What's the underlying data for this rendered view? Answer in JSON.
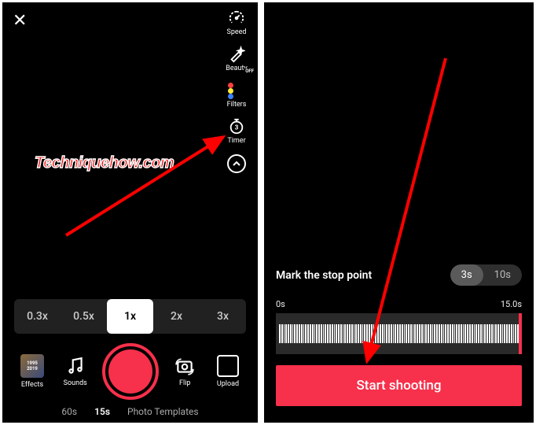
{
  "watermark": "Techniquehow.com",
  "left": {
    "tools": [
      {
        "label": "Speed",
        "name": "speed"
      },
      {
        "label": "Beauty",
        "name": "beauty",
        "off": "OFF"
      },
      {
        "label": "Filters",
        "name": "filters"
      },
      {
        "label": "Timer",
        "name": "timer",
        "badge": "3"
      }
    ],
    "speeds": [
      "0.3x",
      "0.5x",
      "1x",
      "2x",
      "3x"
    ],
    "speed_active": "1x",
    "bottom": {
      "effects": "Effects",
      "sounds": "Sounds",
      "flip": "Flip",
      "upload": "Upload",
      "thumb_top": "1995",
      "thumb_bot": "2019"
    },
    "modes": [
      "60s",
      "15s",
      "Photo Templates"
    ],
    "mode_active": "15s"
  },
  "right": {
    "stop_label": "Mark the stop point",
    "toggle": [
      "3s",
      "10s"
    ],
    "toggle_active": "3s",
    "time_start": "0s",
    "time_end": "15.0s",
    "start_btn": "Start shooting"
  }
}
